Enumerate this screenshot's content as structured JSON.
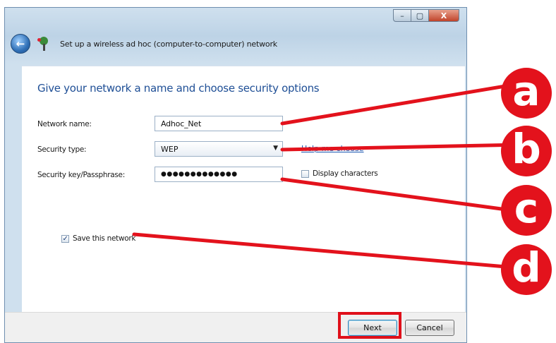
{
  "window": {
    "title": "Set up a wireless ad hoc (computer-to-computer) network",
    "controls": {
      "minimize": "–",
      "maximize": "▢",
      "close": "X"
    }
  },
  "heading": "Give your network a name and choose security options",
  "form": {
    "network_name_label": "Network name:",
    "network_name_value": "Adhoc_Net",
    "security_type_label": "Security type:",
    "security_type_value": "WEP",
    "help_link": "Help me choose",
    "security_key_label": "Security key/Passphrase:",
    "security_key_value": "●●●●●●●●●●●●●",
    "display_characters_label": "Display characters",
    "display_characters_checked": false,
    "save_network_label": "Save this network",
    "save_network_checked": true
  },
  "buttons": {
    "next": "Next",
    "cancel": "Cancel"
  },
  "annotations": {
    "a": "a",
    "b": "b",
    "c": "c",
    "d": "d"
  },
  "colors": {
    "annotation": "#e3121c",
    "heading": "#1f4f96"
  },
  "icons": {
    "back": "back-arrow-icon",
    "network": "wireless-network-icon",
    "dropdown": "chevron-down-icon"
  }
}
